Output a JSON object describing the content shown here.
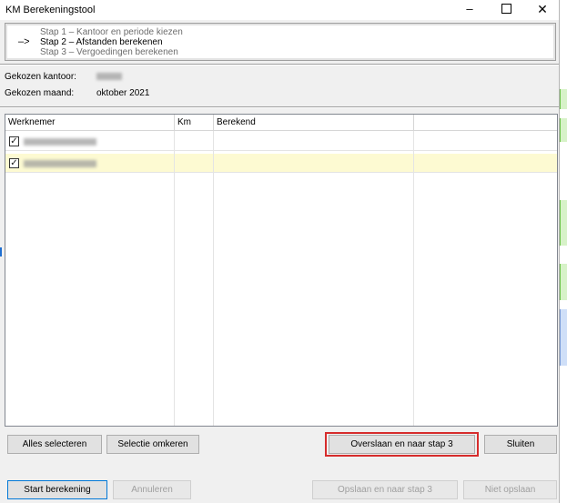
{
  "window": {
    "title": "KM Berekeningstool",
    "controls": {
      "minimize": "–",
      "close": "✕"
    }
  },
  "steps": {
    "arrow": "–>",
    "items": [
      {
        "label": "Stap 1 – Kantoor en periode kiezen",
        "active": false
      },
      {
        "label": "Stap 2 – Afstanden berekenen",
        "active": true
      },
      {
        "label": "Stap 3 – Vergoedingen berekenen",
        "active": false
      }
    ]
  },
  "info": {
    "office_label": "Gekozen kantoor:",
    "month_label": "Gekozen maand:",
    "month_value": "oktober 2021"
  },
  "grid": {
    "columns": [
      "Werknemer",
      "Km",
      "Berekend",
      ""
    ],
    "rows": [
      {
        "checked": true,
        "selected": false,
        "km": "",
        "berekend": ""
      },
      {
        "checked": true,
        "selected": true,
        "km": "",
        "berekend": ""
      }
    ]
  },
  "buttons": {
    "select_all": "Alles selecteren",
    "invert_selection": "Selectie omkeren",
    "skip_to_step3": "Overslaan en naar stap 3",
    "close": "Sluiten",
    "start_calc": "Start berekening",
    "cancel": "Annuleren",
    "save_step3": "Opslaan en naar stap 3",
    "dont_save": "Niet opslaan"
  },
  "colors": {
    "highlight": "#d62c2c",
    "selected_row": "#fdfad2",
    "focus": "#0078d7"
  }
}
